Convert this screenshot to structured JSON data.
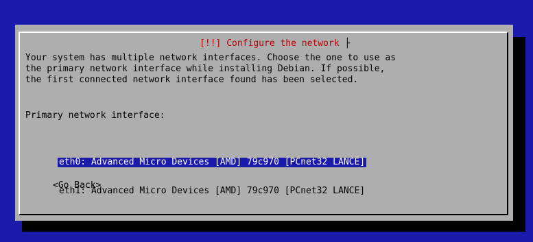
{
  "dialog": {
    "title_marker": "[!!]",
    "title": "Configure the network",
    "description_lines": [
      "Your system has multiple network interfaces. Choose the one to use as",
      "the primary network interface while installing Debian. If possible,",
      "the first connected network interface found has been selected."
    ],
    "prompt": "Primary network interface:",
    "options": [
      {
        "label": "eth0: Advanced Micro Devices [AMD] 79c970 [PCnet32 LANCE]",
        "selected": true
      },
      {
        "label": "eth1: Advanced Micro Devices [AMD] 79c970 [PCnet32 LANCE]",
        "selected": false
      }
    ],
    "go_back_label": "<Go Back>"
  },
  "colors": {
    "screen_background": "#1b1bab",
    "dialog_background": "#aeaeae",
    "title_text": "#c00000",
    "selected_background": "#1b1bab",
    "selected_text": "#ffffff"
  }
}
